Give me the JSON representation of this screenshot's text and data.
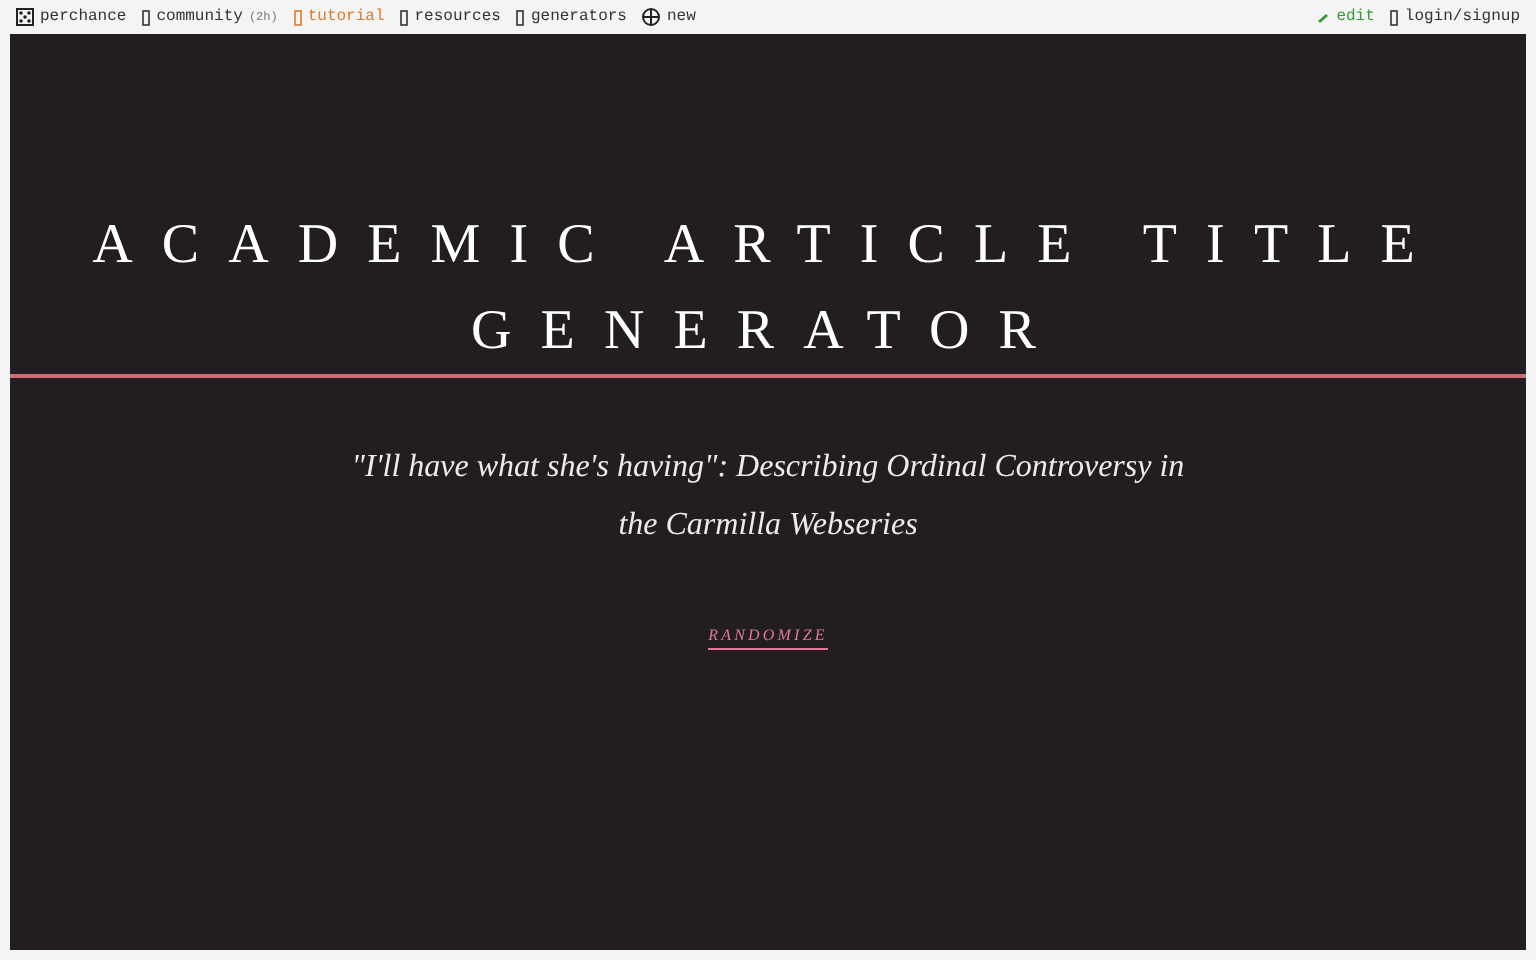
{
  "nav_left": [
    {
      "kind": "logo",
      "label": "perchance",
      "color": "#333333"
    },
    {
      "kind": "link",
      "label": "community",
      "badge": "(2h)",
      "color": "#333333"
    },
    {
      "kind": "link",
      "label": "tutorial",
      "color": "#e07a2a"
    },
    {
      "kind": "link",
      "label": "resources",
      "color": "#333333"
    },
    {
      "kind": "link",
      "label": "generators",
      "color": "#333333"
    },
    {
      "kind": "new",
      "label": "new",
      "color": "#333333"
    }
  ],
  "nav_right": [
    {
      "kind": "edit",
      "label": "edit",
      "color": "#3a9a3a"
    },
    {
      "kind": "link",
      "label": "login/signup",
      "color": "#333333"
    }
  ],
  "title": "ACADEMIC ARTICLE TITLE GENERATOR",
  "result": "\"I'll have what she's having\": Describing Ordinal Controversy in the Carmilla Webseries",
  "button": "RANDOMIZE"
}
